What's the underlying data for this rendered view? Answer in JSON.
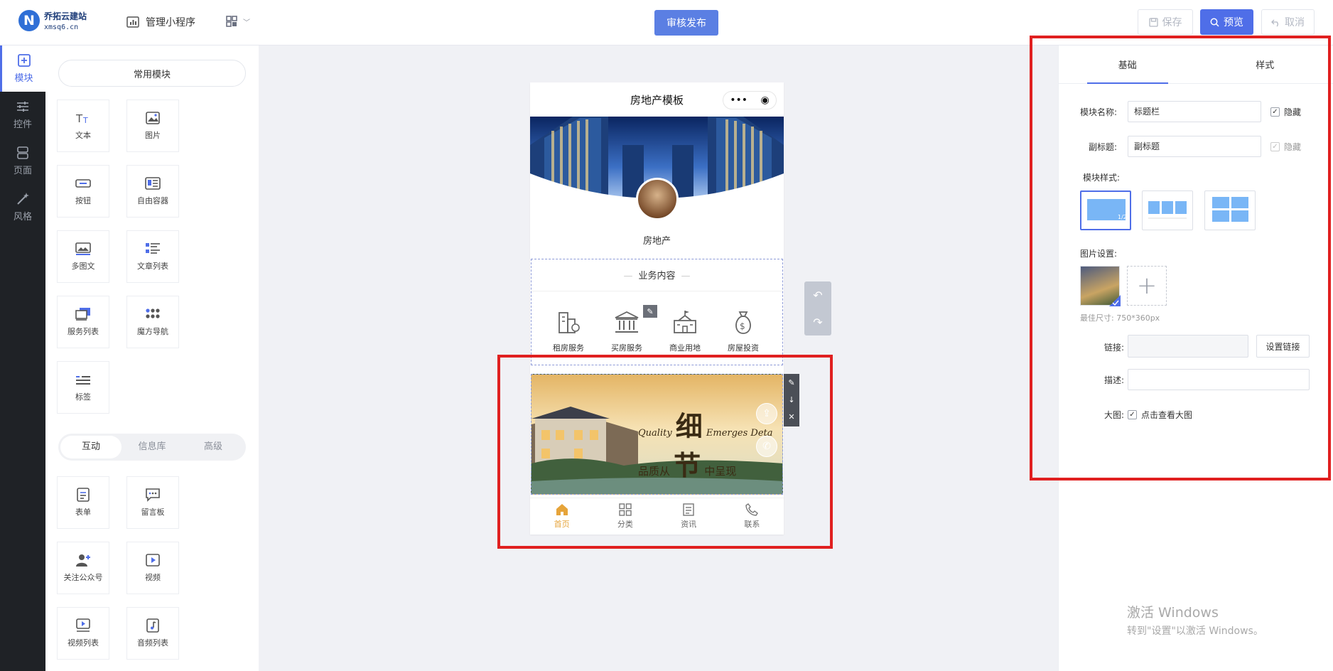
{
  "header": {
    "logo_mark": "N",
    "logo_name": "乔拓云建站",
    "logo_domain": "xmsq6.cn",
    "mini_program": "管理小程序",
    "publish": "审核发布",
    "save": "保存",
    "preview": "预览",
    "cancel": "取消"
  },
  "sidebar": [
    {
      "label": "模块",
      "icon": "plus-box-icon",
      "active": true
    },
    {
      "label": "控件",
      "icon": "sliders-icon",
      "active": false
    },
    {
      "label": "页面",
      "icon": "pages-icon",
      "active": false
    },
    {
      "label": "风格",
      "icon": "magic-wand-icon",
      "active": false
    }
  ],
  "modules": {
    "common_label": "常用模块",
    "common": [
      "文本",
      "图片",
      "按钮",
      "自由容器",
      "多图文",
      "文章列表",
      "服务列表",
      "魔方导航",
      "标签"
    ],
    "tabs": [
      "互动",
      "信息库",
      "高级"
    ],
    "interactive": [
      "表单",
      "留言板",
      "关注公众号",
      "视频",
      "视频列表",
      "音频列表"
    ]
  },
  "phone": {
    "title": "房地产模板",
    "capsule_dots": "•••",
    "company": "房地产",
    "biz_title": "业务内容",
    "services": [
      "租房服务",
      "买房服务",
      "商业用地",
      "房屋投资"
    ],
    "banner_en1": "Quality",
    "banner_en2": "Emerges Deta",
    "banner_cn1": "品质从",
    "banner_big1": "细",
    "banner_big2": "节",
    "banner_cn2": "中呈现",
    "tabs": [
      "首页",
      "分类",
      "资讯",
      "联系"
    ]
  },
  "settings": {
    "tabs": [
      "基础",
      "样式"
    ],
    "module_name_label": "模块名称:",
    "module_name_value": "标题栏",
    "subtitle_label": "副标题:",
    "subtitle_value": "副标题",
    "hide_label": "隐藏",
    "style_label": "模块样式:",
    "style_badge": "1/2",
    "image_label": "图片设置:",
    "size_hint": "最佳尺寸: 750*360px",
    "link_label": "链接:",
    "set_link": "设置链接",
    "desc_label": "描述:",
    "bigimg_label": "大图:",
    "bigimg_option": "点击查看大图"
  },
  "watermark": {
    "line1": "激活 Windows",
    "line2": "转到\"设置\"以激活 Windows。"
  },
  "colors": {
    "accent": "#4f6ee8",
    "highlight": "#e02020",
    "tab_active": "#e6a43a",
    "sidebar_bg": "#1f2226"
  }
}
